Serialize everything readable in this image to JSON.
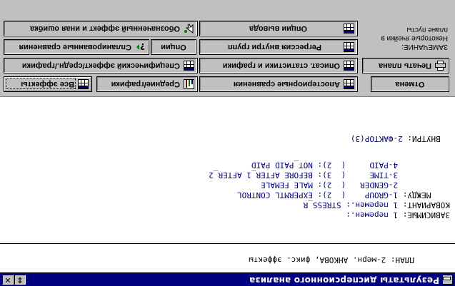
{
  "window": {
    "title": "Результаты дисперсионного анализа",
    "restore_glyph": "⇕",
    "close_glyph": "✕"
  },
  "plan": {
    "text": "ПЛАН: 2-мерн. АНКОВА, фикс. эффекты"
  },
  "output": {
    "lines": [
      {
        "label": "ЗАВИСИМЫЕ: ",
        "value": "1 перемен.:"
      },
      {
        "label": "КОВАРИАНТ: ",
        "value": "1 перемен.: STRESS_R"
      },
      {
        "label": "    МЕЖДУ: ",
        "value": "1-GROUP    (  2): EXPERMTL CONTROL"
      },
      {
        "label": "           ",
        "value": "2-GENDER   (  2): MALE FEMALE"
      },
      {
        "label": "           ",
        "value": "3-TIME     (  3): BEFORE AFTER_1 AFTER_2"
      },
      {
        "label": "           ",
        "value": "4-PAID     (  2): NOT_PAID PAID"
      },
      {
        "label": "  ВНУТРИ: ",
        "value": "2-ФАКТОР(3)"
      }
    ]
  },
  "toolbar": {
    "all_effects": "Все эффекты",
    "means_graphs": "Средние/графики",
    "aposteriori": "Апостериорные сравнения",
    "cancel": "Отмена",
    "specified_effect": "Специфический эффект/средн./графики",
    "descriptive": "Описат. статистики и графики",
    "print_plan": "Печать плана",
    "planned_comparisons": "Спланированные сравнения",
    "options": "Опции",
    "within_regression": "Регрессия внутри групп",
    "significant_effects": "Обозначенный эффект и иная ошибка",
    "output_options": "Опции вывода",
    "note_line1": "ЗАМЕЧАНИЕ:",
    "note_line2": "Некоторые ячейки в",
    "note_line3": "плане пусты"
  },
  "icons": {
    "window": "window-menu-icon",
    "table": "table-icon",
    "chart": "chart-icon",
    "printer": "printer-icon",
    "question": "question-icon",
    "pointer": "pointer-icon"
  }
}
